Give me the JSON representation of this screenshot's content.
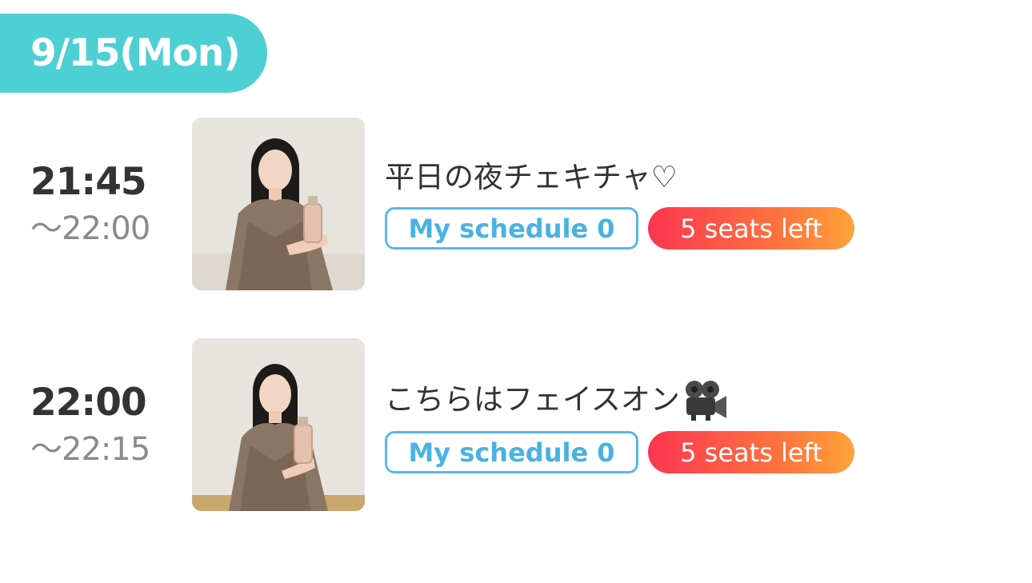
{
  "date_label": "9/15(Mon)",
  "sessions": [
    {
      "time_start": "21:45",
      "time_end": "〜22:00",
      "title": "平日の夜チェキチャ♡",
      "schedule_label": "My schedule 0",
      "seats_label": "5 seats left",
      "thumbnail_icon": "person-photo"
    },
    {
      "time_start": "22:00",
      "time_end": "〜22:15",
      "title": "こちらはフェイスオン",
      "title_icon": "movie-camera-icon",
      "schedule_label": "My schedule 0",
      "seats_label": "5 seats left",
      "thumbnail_icon": "person-photo"
    }
  ],
  "colors": {
    "date_pill": "#4ecfd3",
    "schedule_border": "#57b9e6",
    "seats_gradient_start": "#fc3550",
    "seats_gradient_end": "#ffa43a"
  }
}
